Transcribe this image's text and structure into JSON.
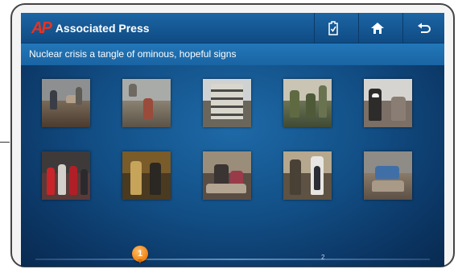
{
  "app": {
    "logo_mark": "AP",
    "title": "Associated Press",
    "accent": "#e33424"
  },
  "toolbar": {
    "buttons": [
      {
        "icon": "clipboard-check-icon"
      },
      {
        "icon": "home-icon"
      },
      {
        "icon": "back-arrow-icon"
      }
    ]
  },
  "headline": "Nuclear crisis a tangle of ominous, hopeful signs",
  "gallery": {
    "rows": 2,
    "columns": 5,
    "thumbnails": [
      {
        "subject": "rescuers in rubble"
      },
      {
        "subject": "person among debris"
      },
      {
        "subject": "damaged building"
      },
      {
        "subject": "soldiers pointing"
      },
      {
        "subject": "masked people"
      },
      {
        "subject": "crowd with luggage"
      },
      {
        "subject": "officials walking"
      },
      {
        "subject": "family at shelter"
      },
      {
        "subject": "worker with papers"
      },
      {
        "subject": "woman in rubble"
      }
    ]
  },
  "pager": {
    "current_page": "1",
    "next_page_label": "2"
  }
}
